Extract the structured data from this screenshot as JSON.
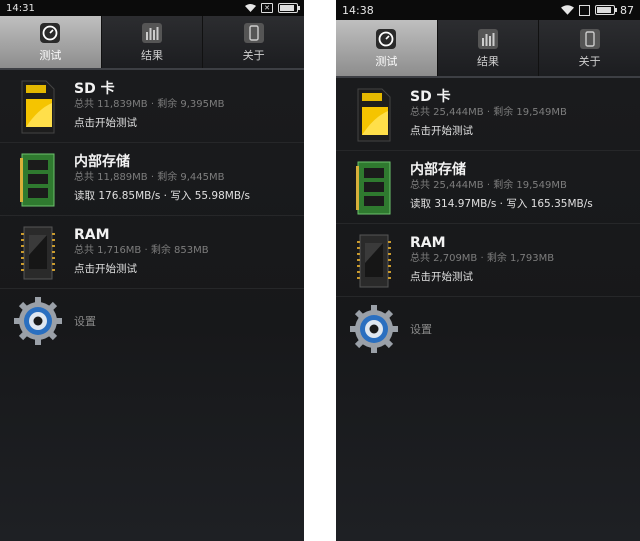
{
  "screens": [
    {
      "status": {
        "time": "14:31",
        "battery_level": 0.9
      },
      "tabs": [
        {
          "label": "测试",
          "icon": "speedometer-icon",
          "active": true
        },
        {
          "label": "结果",
          "icon": "bar-chart-icon",
          "active": false
        },
        {
          "label": "关于",
          "icon": "phone-icon",
          "active": false
        }
      ],
      "items": [
        {
          "title": "SD 卡",
          "subtitle": "总共 11,839MB · 剩余 9,395MB",
          "action": "点击开始测试",
          "icon": "sd-card-icon"
        },
        {
          "title": "内部存储",
          "subtitle": "总共 11,889MB · 剩余 9,445MB",
          "action": "读取 176.85MB/s · 写入 55.98MB/s",
          "icon": "memory-chip-icon"
        },
        {
          "title": "RAM",
          "subtitle": "总共 1,716MB · 剩余 853MB",
          "action": "点击开始测试",
          "icon": "ram-chip-icon"
        }
      ],
      "settings": {
        "label": "设置",
        "icon": "gear-icon"
      }
    },
    {
      "status": {
        "time": "14:38",
        "battery": "87",
        "battery_level": 0.87
      },
      "tabs": [
        {
          "label": "测试",
          "icon": "speedometer-icon",
          "active": true
        },
        {
          "label": "结果",
          "icon": "bar-chart-icon",
          "active": false
        },
        {
          "label": "关于",
          "icon": "phone-icon",
          "active": false
        }
      ],
      "items": [
        {
          "title": "SD 卡",
          "subtitle": "总共 25,444MB · 剩余 19,549MB",
          "action": "点击开始测试",
          "icon": "sd-card-icon"
        },
        {
          "title": "内部存储",
          "subtitle": "总共 25,444MB · 剩余 19,549MB",
          "action": "读取 314.97MB/s · 写入 165.35MB/s",
          "icon": "memory-chip-icon"
        },
        {
          "title": "RAM",
          "subtitle": "总共 2,709MB · 剩余 1,793MB",
          "action": "点击开始测试",
          "icon": "ram-chip-icon"
        }
      ],
      "settings": {
        "label": "设置",
        "icon": "gear-icon"
      }
    }
  ]
}
